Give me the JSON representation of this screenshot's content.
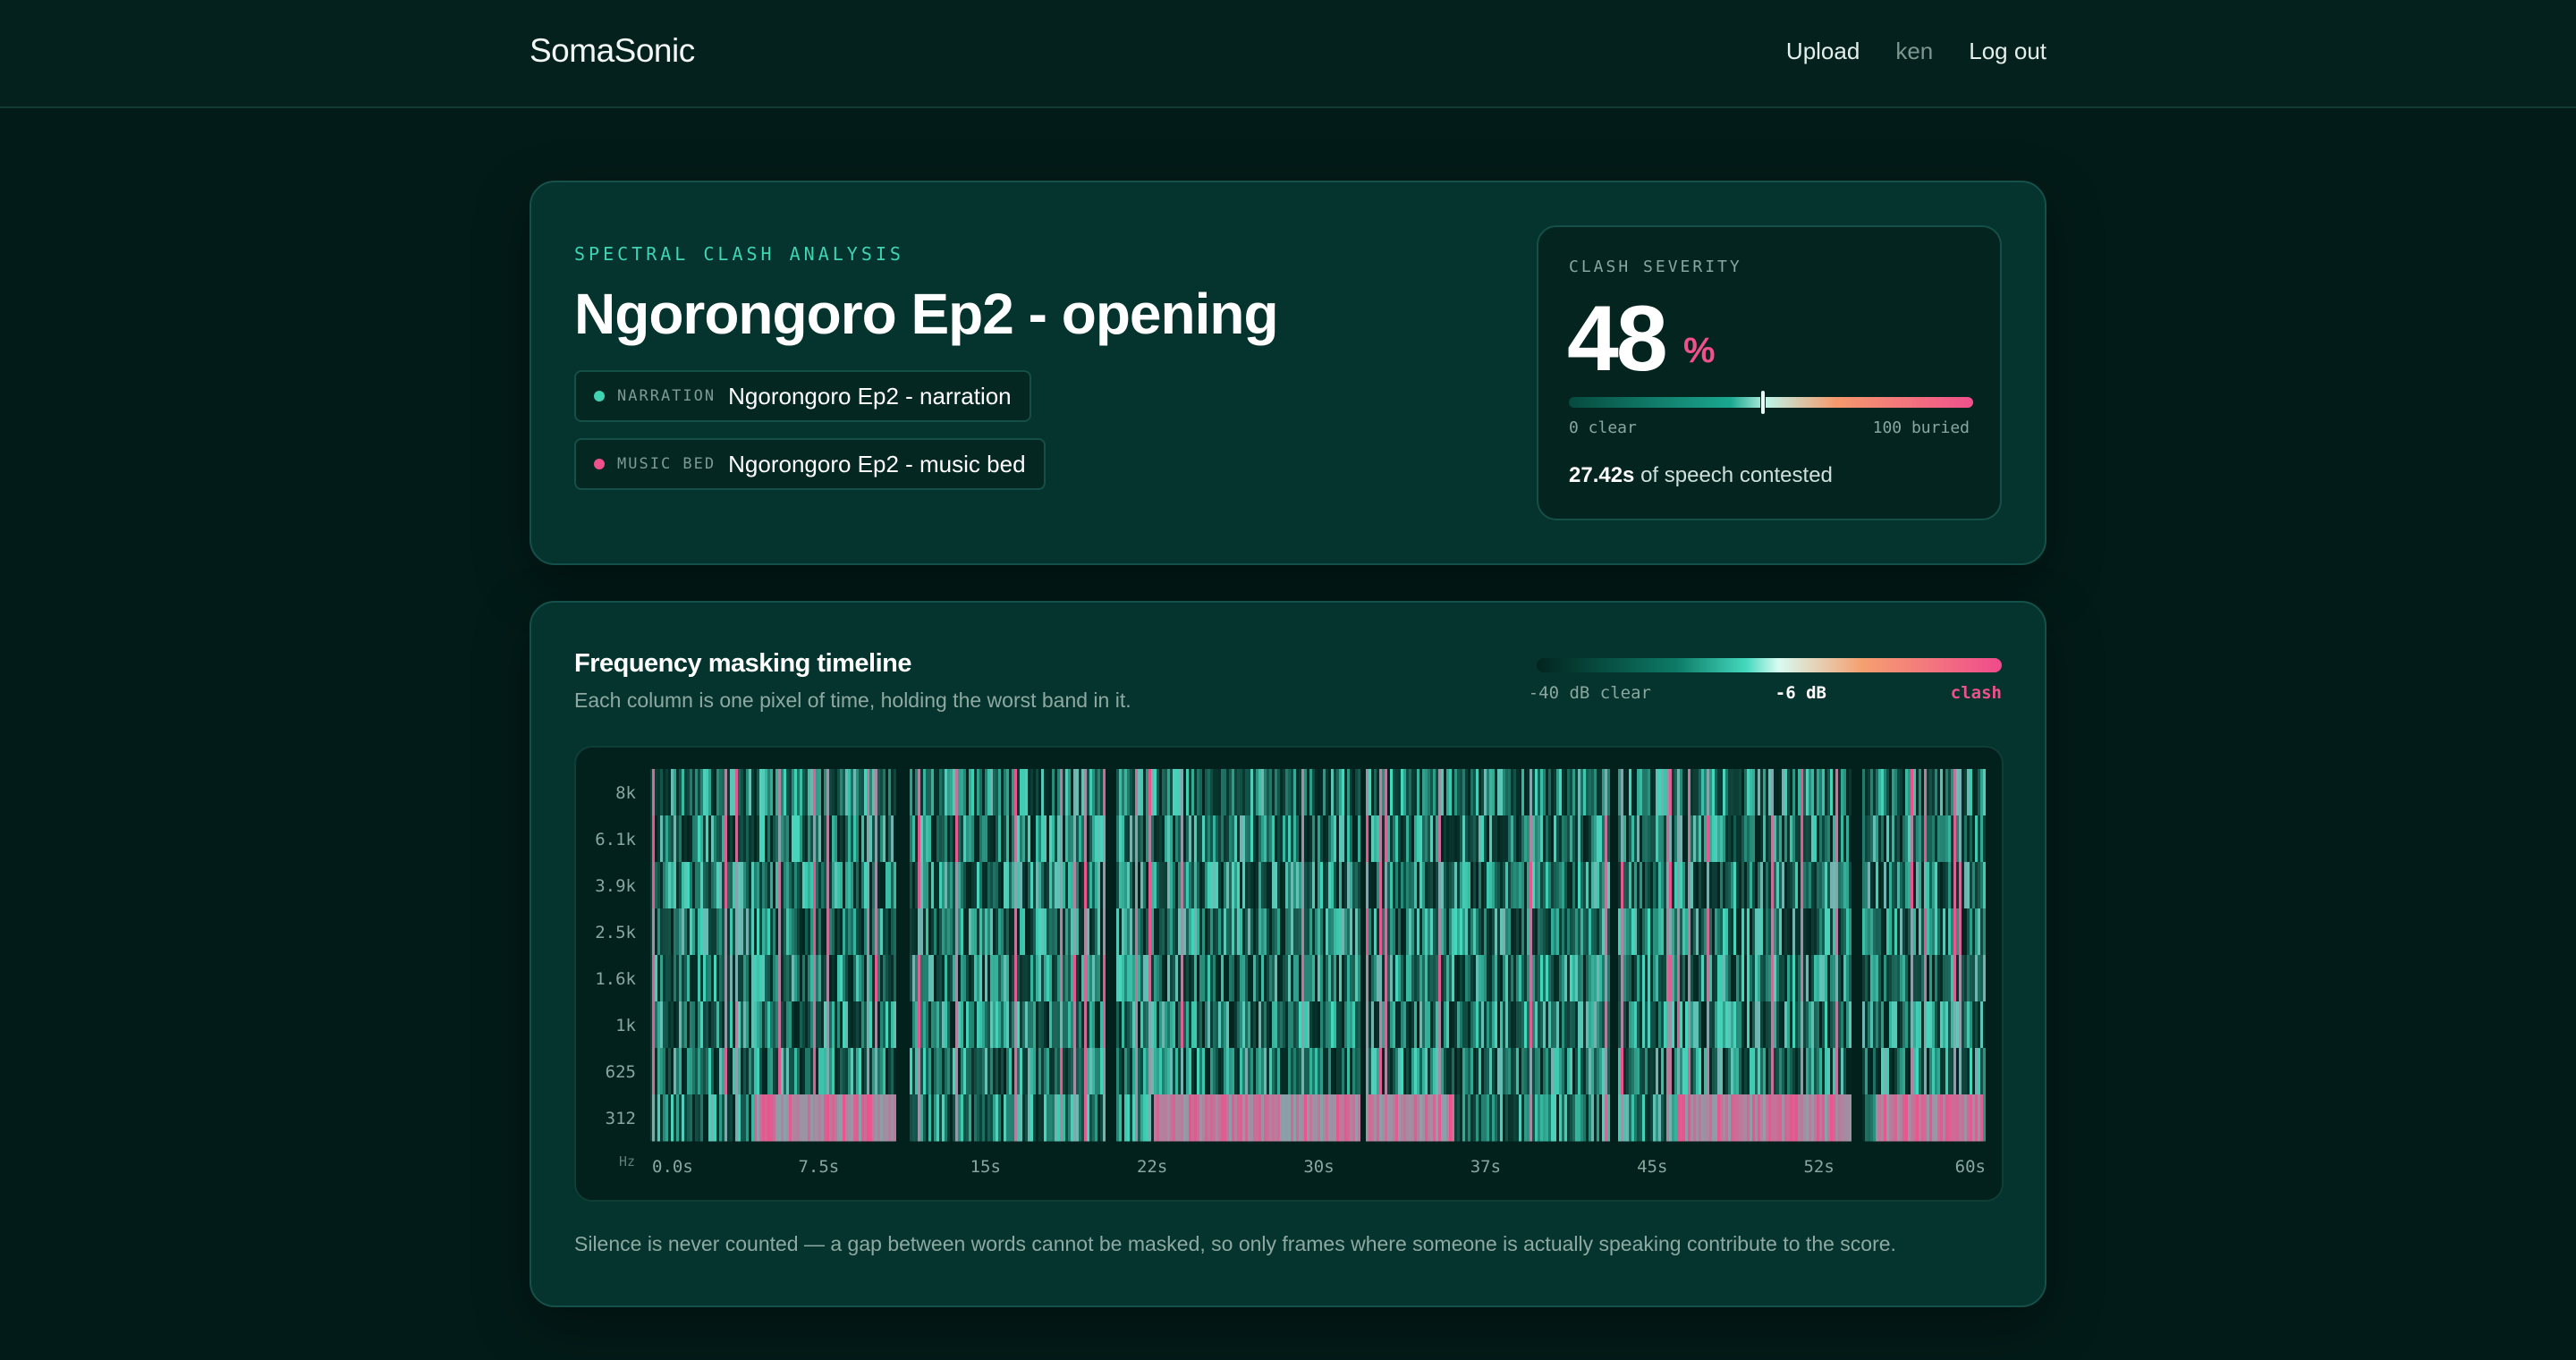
{
  "app": {
    "brand": "SomaSonic",
    "nav": {
      "upload": "Upload",
      "user": "ken",
      "logout": "Log out"
    }
  },
  "analysis": {
    "eyebrow": "SPECTRAL CLASH ANALYSIS",
    "title": "Ngorongoro Ep2 - opening",
    "tracks": [
      {
        "tag": "NARRATION",
        "name": "Ngorongoro Ep2 - narration",
        "color": "#3fd4b4"
      },
      {
        "tag": "MUSIC BED",
        "name": "Ngorongoro Ep2 - music bed",
        "color": "#f0508c"
      }
    ]
  },
  "severity": {
    "label": "CLASH SEVERITY",
    "value": "48",
    "value_number": 48,
    "unit": "%",
    "unit_color": "#f0508c",
    "scale_min_label": "0 clear",
    "scale_max_label": "100 buried",
    "contested_value": "27.42s",
    "contested_suffix": " of speech contested"
  },
  "timeline": {
    "title": "Frequency masking timeline",
    "subtitle": "Each column is one pixel of time, holding the worst band in it.",
    "legend": {
      "left": "-40 dB clear",
      "mid": "-6 dB",
      "right": "clash"
    },
    "note": "Silence is never counted — a gap between words cannot be masked, so only frames where someone is actually speaking contribute to the score."
  },
  "chart_data": {
    "type": "heatmap",
    "title": "Frequency masking timeline",
    "y_unit_label": "Hz",
    "bands": [
      "8k",
      "6.1k",
      "3.9k",
      "2.5k",
      "1.6k",
      "1k",
      "625",
      "312"
    ],
    "x_ticks": [
      "0.0s",
      "7.5s",
      "15s",
      "22s",
      "30s",
      "37s",
      "45s",
      "52s",
      "60s"
    ],
    "x_range": [
      0,
      60
    ],
    "value_range_db": [
      -40,
      0
    ],
    "threshold_db": -6,
    "colors": {
      "clear": "#03241f",
      "mid": "#43d8bd",
      "clash": "#f0508c"
    },
    "silent_gaps_s": [
      [
        10.9,
        11.5
      ],
      [
        20.3,
        20.8
      ],
      [
        31.8,
        32.1
      ],
      [
        43.0,
        43.4
      ],
      [
        53.9,
        54.4
      ]
    ],
    "strong_clash_band": "312",
    "strong_clash_regions_s": [
      [
        4.5,
        10.9
      ],
      [
        22.5,
        31.8
      ],
      [
        32.1,
        36.0
      ],
      [
        46.0,
        53.9
      ],
      [
        55.0,
        59.8
      ]
    ]
  }
}
